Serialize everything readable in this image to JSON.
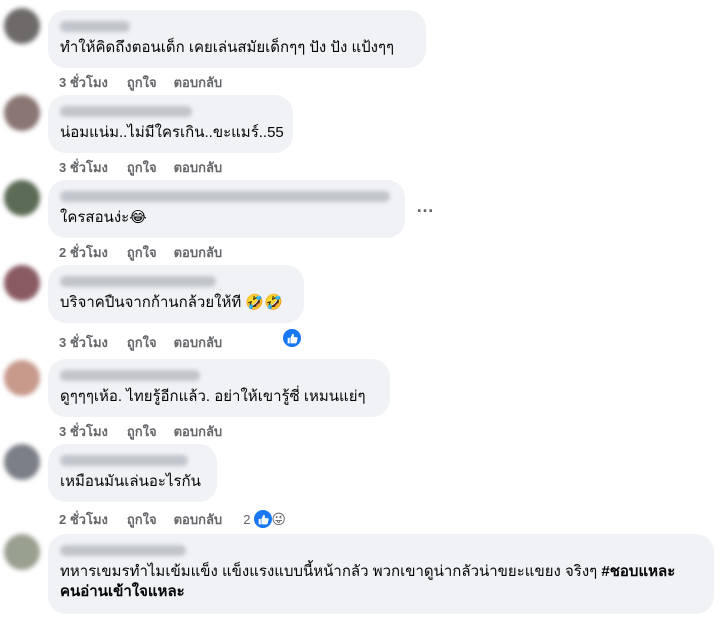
{
  "comments": [
    {
      "text": "ทำให้คิดถึงตอนเด็ก เคยเล่นสมัยเด็กๆๆ ปัง ปัง แป้งๆๆ",
      "time": "3 ชั่วโมง",
      "like": "ถูกใจ",
      "reply": "ตอบกลับ"
    },
    {
      "text": "น่อมแน่ม..ไม่มีใครเกิน..ขะแมร์..55",
      "time": "3 ชั่วโมง",
      "like": "ถูกใจ",
      "reply": "ตอบกลับ"
    },
    {
      "text": "ใครสอนง่ะ😂",
      "time": "2 ชั่วโมง",
      "like": "ถูกใจ",
      "reply": "ตอบกลับ",
      "more": "…"
    },
    {
      "text": "บริจาคปืนจากก้านกล้วยให้ที 🤣🤣",
      "time": "3 ชั่วโมง",
      "like": "ถูกใจ",
      "reply": "ตอบกลับ"
    },
    {
      "text": "ดูๆๆๆเห้อ. ไทยรู้อีกแล้ว. อย่าให้เขารู้ซี่ เหมนแย่ๆ",
      "time": "3 ชั่วโมง",
      "like": "ถูกใจ",
      "reply": "ตอบกลับ"
    },
    {
      "text": "เหมือนมันเล่นอะไรกัน",
      "time": "2 ชั่วโมง",
      "like": "ถูกใจ",
      "reply": "ตอบกลับ",
      "reaction_count": "2",
      "reaction_emoji": "😜"
    },
    {
      "text_line1": "ทหารเขมรทำไมเข้มแข็ง แข็งแรงแบบนี้หน้ากลัว พวกเขาดูน่ากลัวน่าขยะแขยง จริงๆ ",
      "hashtag_part1": "#ชอบแหละ",
      "hashtag_part2": "คนอ่านเข้าใจแหละ"
    }
  ],
  "colors": {
    "bubble": "#f0f2f5",
    "meta_text": "#65676b",
    "like_blue": "#1877f2",
    "avatars": [
      "#6e6a6a",
      "#8a7672",
      "#5b6b55",
      "#8a5a63",
      "#c79a8c",
      "#7b7f86",
      "#9aa090"
    ]
  }
}
